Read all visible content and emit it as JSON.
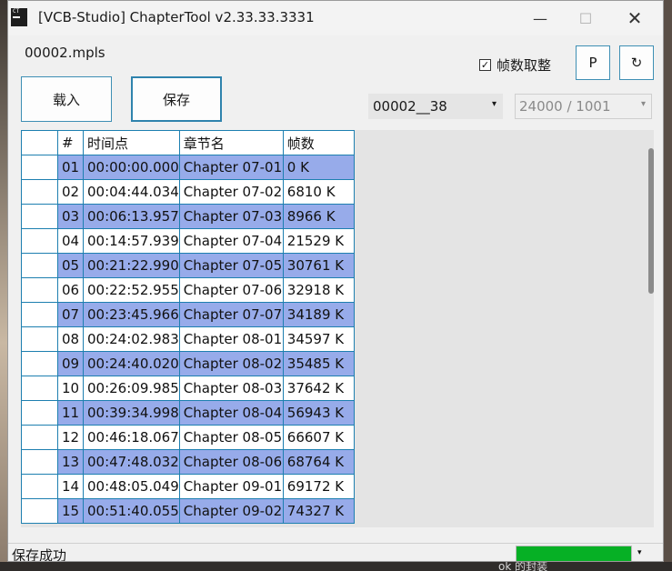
{
  "window": {
    "title": "[VCB-Studio] ChapterTool v2.33.33.3331",
    "minimize_glyph": "—",
    "maximize_glyph": "☐",
    "close_glyph": "✕"
  },
  "file_label": "00002.mpls",
  "frame_round": {
    "label": "帧数取整",
    "checked": true,
    "check_glyph": "✓"
  },
  "buttons": {
    "load": "载入",
    "save": "保存",
    "p": "P",
    "refresh": "↻"
  },
  "mpls_select": {
    "value": "00002__38",
    "arrow": "▾"
  },
  "fps_select": {
    "value": "24000 / 1001",
    "arrow": "▾"
  },
  "table": {
    "headers": [
      "",
      "#",
      "时间点",
      "章节名",
      "帧数"
    ],
    "rows": [
      [
        "01",
        "00:00:00.000",
        "Chapter 07-01",
        "0 K"
      ],
      [
        "02",
        "00:04:44.034",
        "Chapter 07-02",
        "6810 K"
      ],
      [
        "03",
        "00:06:13.957",
        "Chapter 07-03",
        "8966 K"
      ],
      [
        "04",
        "00:14:57.939",
        "Chapter 07-04",
        "21529 K"
      ],
      [
        "05",
        "00:21:22.990",
        "Chapter 07-05",
        "30761 K"
      ],
      [
        "06",
        "00:22:52.955",
        "Chapter 07-06",
        "32918 K"
      ],
      [
        "07",
        "00:23:45.966",
        "Chapter 07-07",
        "34189 K"
      ],
      [
        "08",
        "00:24:02.983",
        "Chapter 08-01",
        "34597 K"
      ],
      [
        "09",
        "00:24:40.020",
        "Chapter 08-02",
        "35485 K"
      ],
      [
        "10",
        "00:26:09.985",
        "Chapter 08-03",
        "37642 K"
      ],
      [
        "11",
        "00:39:34.998",
        "Chapter 08-04",
        "56943 K"
      ],
      [
        "12",
        "00:46:18.067",
        "Chapter 08-05",
        "66607 K"
      ],
      [
        "13",
        "00:47:48.032",
        "Chapter 08-06",
        "68764 K"
      ],
      [
        "14",
        "00:48:05.049",
        "Chapter 09-01",
        "69172 K"
      ],
      [
        "15",
        "00:51:40.055",
        "Chapter 09-02",
        "74327 K"
      ]
    ]
  },
  "status": {
    "text": "保存成功",
    "progress": 1.0,
    "arrow": "▾"
  },
  "desktop": {
    "partial_text": "ok 的封装"
  },
  "colors": {
    "row_highlight": "#97abea",
    "grid_border": "#1d7fb0",
    "progress": "#06b025"
  }
}
